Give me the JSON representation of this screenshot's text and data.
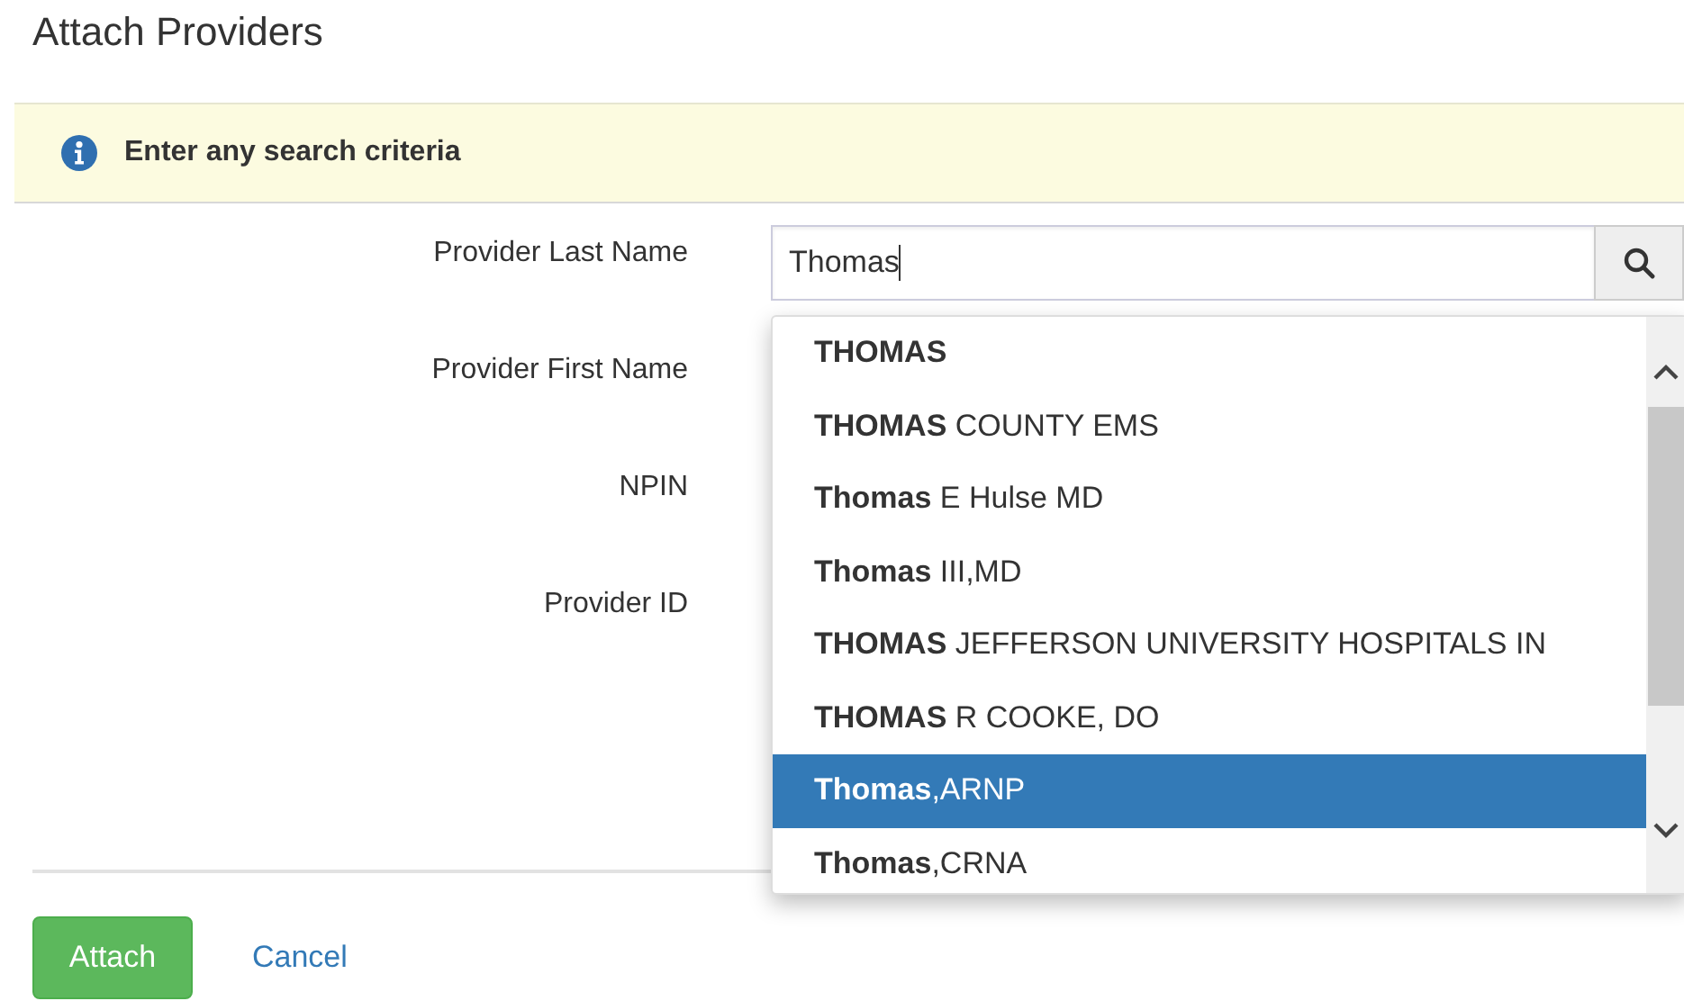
{
  "dialog": {
    "title": "Attach Providers"
  },
  "alert": {
    "message": "Enter any search criteria"
  },
  "fields": [
    {
      "label": "Provider Last Name",
      "value": "Thomas"
    },
    {
      "label": "Provider First Name"
    },
    {
      "label": "NPIN"
    },
    {
      "label": "Provider ID"
    }
  ],
  "suggestions": [
    {
      "text": "**THOMAS**",
      "selected": false
    },
    {
      "text": "**THOMAS** COUNTY EMS",
      "selected": false
    },
    {
      "text": "**Thomas** E Hulse MD",
      "selected": false
    },
    {
      "text": "**Thomas** III,MD",
      "selected": false
    },
    {
      "text": "**THOMAS** JEFFERSON UNIVERSITY HOSPITALS IN",
      "selected": false
    },
    {
      "text": "**THOMAS** R COOKE, DO",
      "selected": false
    },
    {
      "text": "**Thomas**,ARNP",
      "selected": true
    },
    {
      "text": "**Thomas**,CRNA",
      "selected": false
    }
  ],
  "buttons": {
    "primary": "Attach",
    "secondary": "Cancel"
  }
}
